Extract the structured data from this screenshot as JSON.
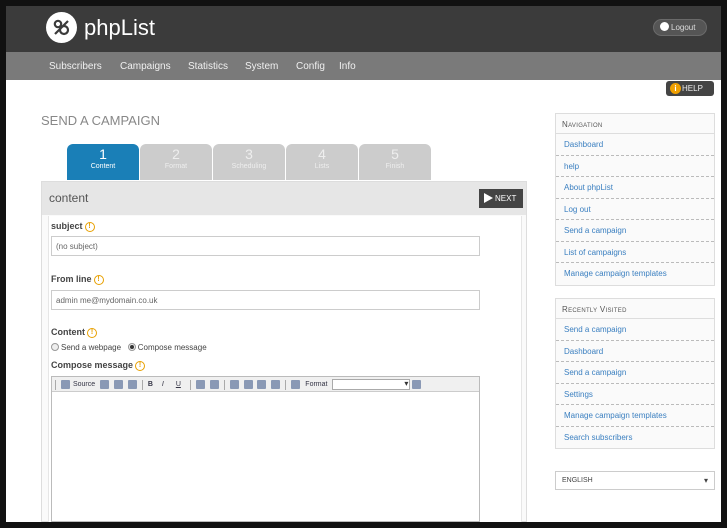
{
  "app": {
    "brand": "phpList",
    "logout_label": "Logout",
    "help_label": "HELP"
  },
  "nav": {
    "items": [
      "Subscribers",
      "Campaigns",
      "Statistics",
      "System",
      "Config",
      "Info"
    ]
  },
  "page": {
    "title": "SEND A CAMPAIGN"
  },
  "steps": [
    {
      "num": "1",
      "label": "Content",
      "active": true
    },
    {
      "num": "2",
      "label": "Format",
      "active": false
    },
    {
      "num": "3",
      "label": "Scheduling",
      "active": false
    },
    {
      "num": "4",
      "label": "Lists",
      "active": false
    },
    {
      "num": "5",
      "label": "Finish",
      "active": false
    }
  ],
  "content": {
    "header": "content",
    "next_label": "NEXT",
    "subject_label": "subject",
    "subject_value": "(no subject)",
    "from_label": "From line",
    "from_value": "admin me@mydomain.co.uk",
    "content_label": "Content",
    "radio_webpage": "Send a webpage",
    "radio_compose": "Compose message",
    "compose_label": "Compose message",
    "toolbar_source": "Source",
    "toolbar_format": "Format"
  },
  "sidebar": {
    "navigation": {
      "title": "Navigation",
      "items": [
        "Dashboard",
        "help",
        "About phpList",
        "Log out",
        "Send a campaign",
        "List of campaigns",
        "Manage campaign templates"
      ]
    },
    "recent": {
      "title": "Recently Visited",
      "items": [
        "Send a campaign",
        "Dashboard",
        "Send a campaign",
        "Settings",
        "Manage campaign templates",
        "Search subscribers"
      ]
    },
    "language": "ENGLISH"
  },
  "colors": {
    "accent": "#1a7fb7",
    "topbar": "#3b3b3b",
    "navbar": "#7a7a7a",
    "link": "#3a7fc0",
    "help_orange": "#e8a000"
  }
}
